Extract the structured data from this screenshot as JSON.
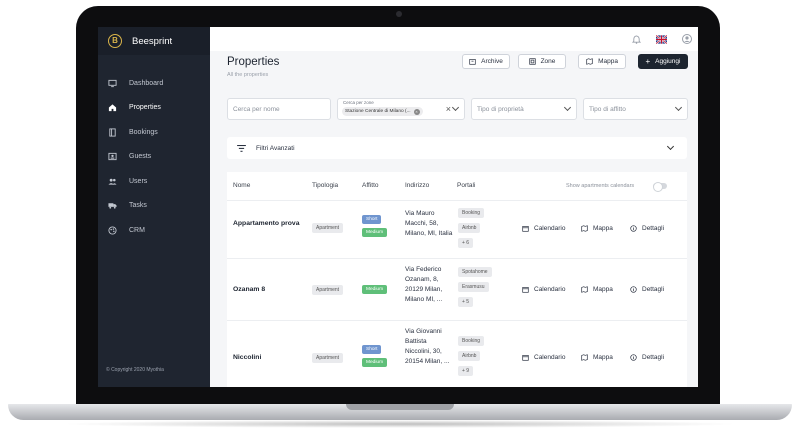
{
  "app": {
    "name": "Beesprint",
    "logo_letter": "B"
  },
  "sidebar": {
    "items": [
      {
        "label": "Dashboard",
        "icon": "monitor-icon"
      },
      {
        "label": "Properties",
        "icon": "home-icon"
      },
      {
        "label": "Bookings",
        "icon": "book-icon"
      },
      {
        "label": "Guests",
        "icon": "id-card-icon"
      },
      {
        "label": "Users",
        "icon": "users-icon"
      },
      {
        "label": "Tasks",
        "icon": "truck-icon"
      },
      {
        "label": "CRM",
        "icon": "palette-icon"
      }
    ],
    "active": "Properties",
    "copyright": "© Copyright 2020 Myothia"
  },
  "topbar": {
    "icons": [
      "bell-icon",
      "uk-flag-icon",
      "user-avatar-icon"
    ]
  },
  "header": {
    "title": "Properties",
    "subtitle": "All the properties",
    "buttons": {
      "archive": "Archive",
      "zone": "Zone",
      "map": "Mappa",
      "add": "Aggiungi"
    }
  },
  "filters": {
    "search_placeholder": "Cerca per nome",
    "zone_label": "Cerca per zone",
    "zone_chip": "Stazione Centrale di Milano (...",
    "property_type_placeholder": "Tipo di proprietà",
    "rent_type_placeholder": "Tipo di affitto",
    "advanced": "Filtri Avanzati"
  },
  "table": {
    "columns": {
      "name": "Nome",
      "type": "Tipologia",
      "rent": "Affitto",
      "address": "Indirizzo",
      "portals": "Portali"
    },
    "calendar_toggle": "Show apartments calendars",
    "actions": {
      "calendar": "Calendario",
      "map": "Mappa",
      "details": "Dettagli"
    },
    "rows": [
      {
        "name": "Appartamento prova",
        "type": "Apartment",
        "rent": [
          "Short",
          "Medium"
        ],
        "address": "Via Mauro Macchi, 58, Milano, MI, Italia",
        "portals": [
          "Booking",
          "Airbnb",
          "+ 6"
        ]
      },
      {
        "name": "Ozanam 8",
        "type": "Apartment",
        "rent": [
          "Medium"
        ],
        "address": "Via Federico Ozanam, 8, 20129 Milan, Milano MI, ...",
        "portals": [
          "Spotahome",
          "Erasmusu",
          "+ 5"
        ]
      },
      {
        "name": "Niccolini",
        "type": "Apartment",
        "rent": [
          "Short",
          "Medium"
        ],
        "address": "Via Giovanni Battista Niccolini, 30, 20154 Milan, ...",
        "portals": [
          "Booking",
          "Airbnb",
          "+ 9"
        ]
      }
    ]
  },
  "colors": {
    "sidebar": "#1f2530",
    "primary_button": "#1d2530",
    "short_pill": "#6f95cf",
    "medium_pill": "#5fbf79",
    "logo": "#d9b44a"
  }
}
